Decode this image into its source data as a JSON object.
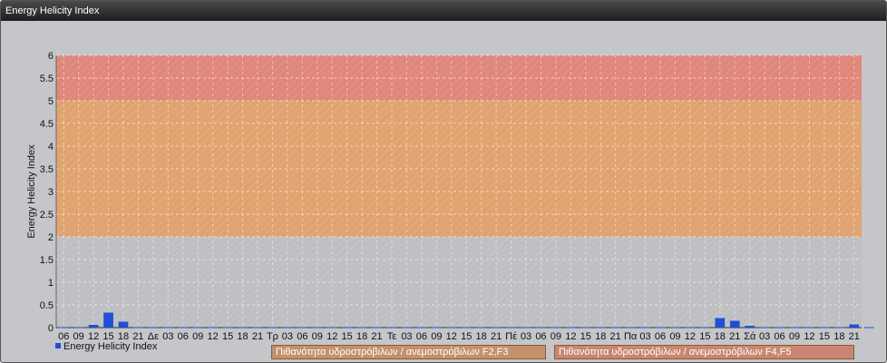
{
  "window": {
    "title": "Energy Helicity Index"
  },
  "colors": {
    "zone_high": "#e0867a",
    "zone_mid": "#e0a36f",
    "bar": "#1f4fd8",
    "plot_bg": "#bdbfc2",
    "legend_f2f3_bg": "#c4916a",
    "legend_f4f5_bg": "#c98670"
  },
  "chart_data": {
    "type": "bar",
    "title": "",
    "ylabel": "Energy Helicity Index",
    "xlabel": "",
    "ylim": [
      0,
      6
    ],
    "yticks": [
      "0",
      "0.5",
      "1",
      "1.5",
      "2",
      "2.5",
      "3",
      "3.5",
      "4",
      "4.5",
      "5",
      "5.5",
      "6"
    ],
    "grid": true,
    "legend_position": "bottom-left",
    "categories": [
      "06",
      "09",
      "12",
      "15",
      "18",
      "21",
      "Δε",
      "03",
      "06",
      "09",
      "12",
      "15",
      "18",
      "21",
      "Τρ",
      "03",
      "06",
      "09",
      "12",
      "15",
      "18",
      "21",
      "Τε",
      "03",
      "06",
      "09",
      "12",
      "15",
      "18",
      "21",
      "Πέ",
      "03",
      "06",
      "09",
      "12",
      "15",
      "18",
      "21",
      "Πα",
      "03",
      "06",
      "09",
      "12",
      "15",
      "18",
      "21",
      "Σά",
      "03",
      "06",
      "09",
      "12",
      "15",
      "18",
      "21"
    ],
    "series": [
      {
        "name": "Energy Helicity Index",
        "values": [
          0.01,
          0.01,
          0.06,
          0.33,
          0.13,
          0.01,
          0.01,
          0.01,
          0.01,
          0.01,
          0.01,
          0.01,
          0.01,
          0.01,
          0.01,
          0.01,
          0.01,
          0.01,
          0.01,
          0.01,
          0.01,
          0.01,
          0.01,
          0.01,
          0.01,
          0.01,
          0.01,
          0.01,
          0.01,
          0.01,
          0.01,
          0.01,
          0.01,
          0.01,
          0.01,
          0.01,
          0.01,
          0.01,
          0.01,
          0.01,
          0.01,
          0.01,
          0.01,
          0.01,
          0.21,
          0.15,
          0.04,
          0.01,
          0.01,
          0.01,
          0.01,
          0.01,
          0.01,
          0.07,
          0.01
        ]
      }
    ],
    "zones": [
      {
        "from": 2,
        "to": 5,
        "label": "Πιθανότητα υδροστρόβιλων / ανεμοστρόβιλων F2,F3"
      },
      {
        "from": 5,
        "to": 6,
        "label": "Πιθανότητα υδροστρόβιλων / ανεμοστρόβιλων F4,F5"
      }
    ]
  }
}
